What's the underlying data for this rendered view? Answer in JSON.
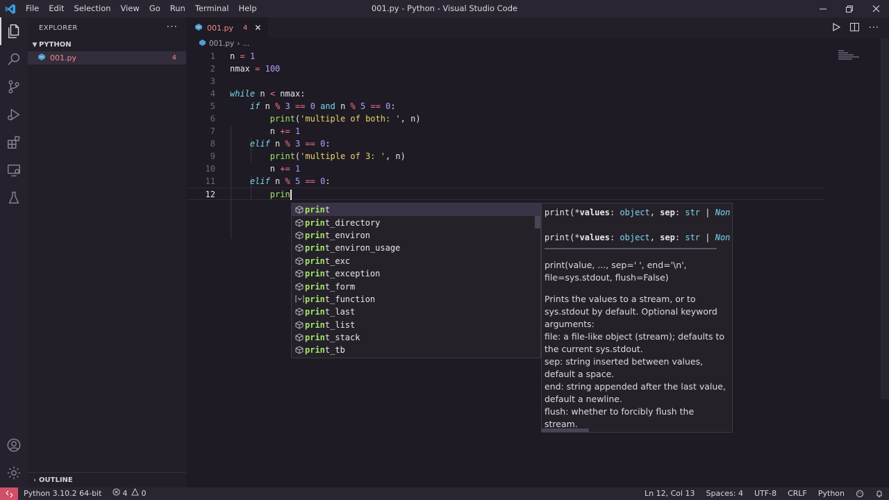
{
  "titlebar": {
    "menu": [
      "File",
      "Edit",
      "Selection",
      "View",
      "Go",
      "Run",
      "Terminal",
      "Help"
    ],
    "title": "001.py - Python - Visual Studio Code"
  },
  "activity": [
    "explorer-icon",
    "search-icon",
    "source-control-icon",
    "run-debug-icon",
    "extensions-icon",
    "remote-explorer-icon",
    "testing-icon",
    "account-icon",
    "settings-gear-icon"
  ],
  "sidebar": {
    "header": "EXPLORER",
    "more": "···",
    "folder": "PYTHON",
    "file": {
      "name": "001.py",
      "problems": "4"
    },
    "outline": "OUTLINE"
  },
  "editor": {
    "tab": {
      "name": "001.py",
      "problems": "4"
    },
    "breadcrumb": {
      "file": "001.py",
      "rest": "..."
    },
    "lines": [
      {
        "n": "1"
      },
      {
        "n": "2"
      },
      {
        "n": "3"
      },
      {
        "n": "4"
      },
      {
        "n": "5"
      },
      {
        "n": "6"
      },
      {
        "n": "7"
      },
      {
        "n": "8"
      },
      {
        "n": "9"
      },
      {
        "n": "10"
      },
      {
        "n": "11"
      },
      {
        "n": "12"
      }
    ],
    "tokens": {
      "l1_var": "n",
      "l1_op": "=",
      "l1_num": "1",
      "l2_var": "nmax",
      "l2_op": "=",
      "l2_num": "100",
      "l4_kw": "while",
      "l4_a": "n",
      "l4_op": "<",
      "l4_b": "nmax:",
      "l5_kw": "if",
      "l5_a": "n",
      "l5_op1": "%",
      "l5_n1": "3",
      "l5_op2": "==",
      "l5_n2": "0",
      "l5_and": "and",
      "l5_b": "n",
      "l5_op3": "%",
      "l5_n3": "5",
      "l5_op4": "==",
      "l5_n4": "0",
      "l5_colon": ":",
      "l6_fn": "print",
      "l6_open": "(",
      "l6_str": "'multiple of both: '",
      "l6_rest": ", n)",
      "l7_var": "n",
      "l7_op": "+=",
      "l7_num": "1",
      "l8_kw": "elif",
      "l8_a": "n",
      "l8_op1": "%",
      "l8_n1": "3",
      "l8_op2": "==",
      "l8_n2": "0",
      "l8_colon": ":",
      "l9_fn": "print",
      "l9_open": "(",
      "l9_str": "'multiple of 3: '",
      "l9_rest": ", n)",
      "l10_var": "n",
      "l10_op": "+=",
      "l10_num": "1",
      "l11_kw": "elif",
      "l11_a": "n",
      "l11_op1": "%",
      "l11_n1": "5",
      "l11_op2": "==",
      "l11_n2": "0",
      "l11_colon": ":",
      "l12_text": "prin"
    }
  },
  "suggest": {
    "match": "prin",
    "items": [
      {
        "label_rest": "t",
        "kind": "method"
      },
      {
        "label_rest": "t_directory",
        "kind": "method"
      },
      {
        "label_rest": "t_environ",
        "kind": "method"
      },
      {
        "label_rest": "t_environ_usage",
        "kind": "method"
      },
      {
        "label_rest": "t_exc",
        "kind": "method"
      },
      {
        "label_rest": "t_exception",
        "kind": "method"
      },
      {
        "label_rest": "t_form",
        "kind": "method"
      },
      {
        "label_rest": "t_function",
        "kind": "variable"
      },
      {
        "label_rest": "t_last",
        "kind": "method"
      },
      {
        "label_rest": "t_list",
        "kind": "method"
      },
      {
        "label_rest": "t_stack",
        "kind": "method"
      },
      {
        "label_rest": "t_tb",
        "kind": "method"
      }
    ]
  },
  "docs": {
    "sig1": {
      "a": "print(*",
      "b": "values",
      "c": ": ",
      "d": "object",
      "e": ", ",
      "f": "sep",
      "g": ": ",
      "h": "str",
      "i": " | ",
      "j": "Non"
    },
    "sig2": {
      "a": "print(*",
      "b": "values",
      "c": ": ",
      "d": "object",
      "e": ", ",
      "f": "sep",
      "g": ": ",
      "h": "str",
      "i": " | ",
      "j": "Non"
    },
    "usage1": "print(value, ..., sep=' ', end='\\n',",
    "usage2": "file=sys.stdout, flush=False)",
    "p1": "Prints the values to a stream, or to",
    "p2": "sys.stdout by default. Optional keyword",
    "p3": "arguments:",
    "p4": "file: a file-like object (stream); defaults to",
    "p5": "the current sys.stdout.",
    "p6": "sep: string inserted between values,",
    "p7": "default a space.",
    "p8": "end: string appended after the last value,",
    "p9": "default a newline.",
    "p10": "flush: whether to forcibly flush the",
    "p11": "stream."
  },
  "statusbar": {
    "interpreter": "Python 3.10.2 64-bit",
    "errors": "4",
    "warnings": "0",
    "position": "Ln 12, Col 13",
    "spaces": "Spaces: 4",
    "encoding": "UTF-8",
    "eol": "CRLF",
    "language": "Python"
  },
  "colors": {
    "accent": "#d0506a",
    "error": "#f08c84",
    "keyword": "#7ad7f0",
    "function": "#a4e36a",
    "string": "#e8d56a",
    "number": "#b39dff",
    "operator": "#ff6f8f"
  }
}
